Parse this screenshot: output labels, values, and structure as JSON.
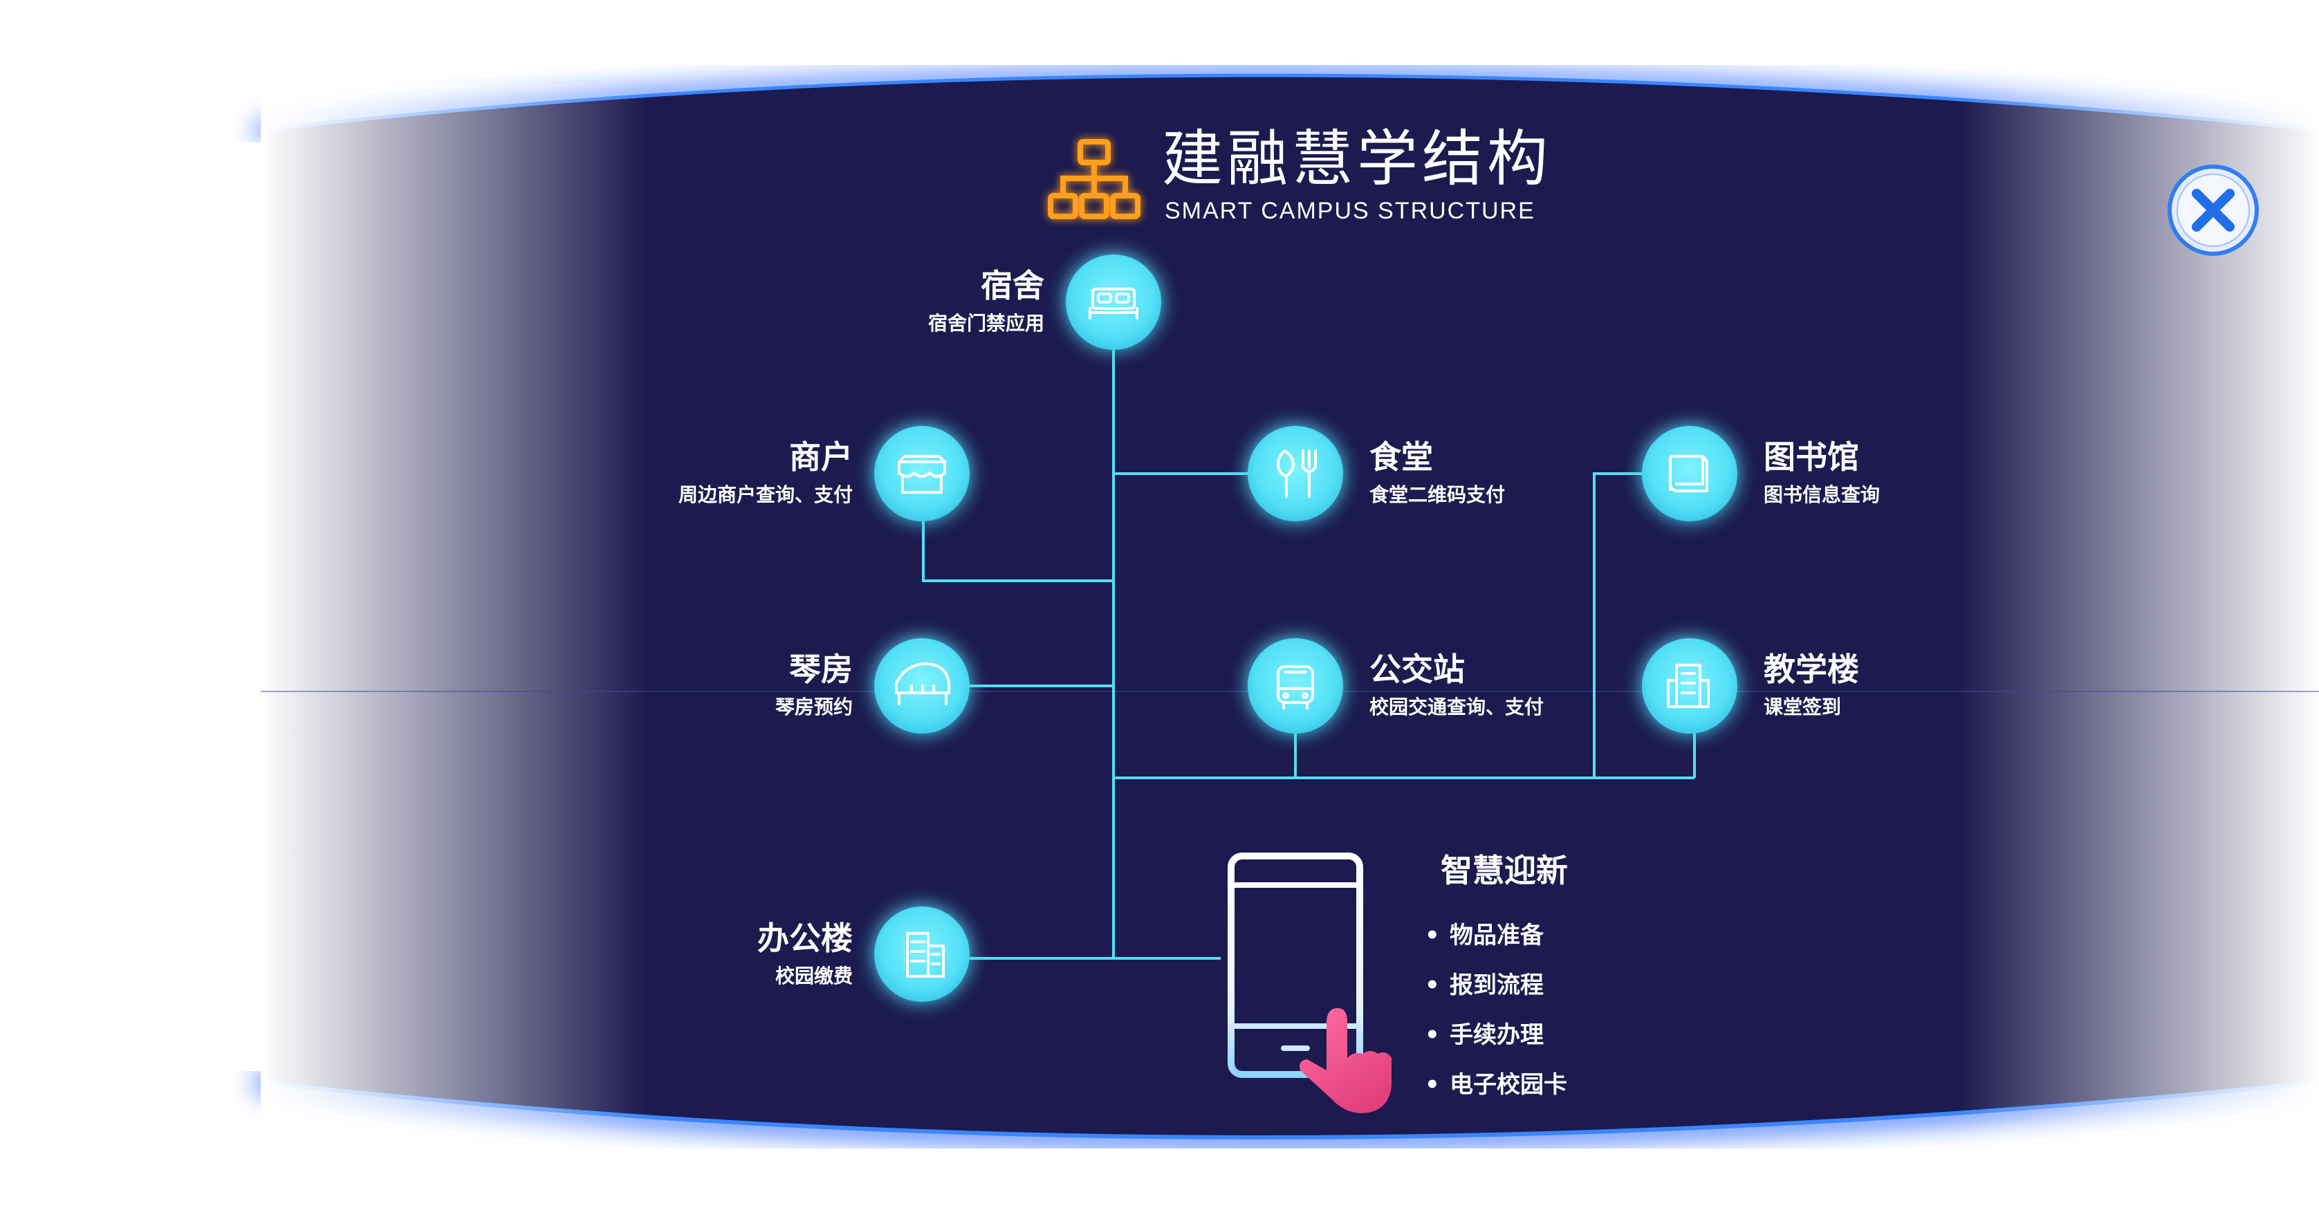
{
  "header": {
    "title": "建融慧学结构",
    "subtitle": "SMART CAMPUS STRUCTURE",
    "logo_icon": "org-chart-icon"
  },
  "close_button_icon": "close-icon",
  "colors": {
    "panel": "#1c1a4e",
    "node": "#5fe8fb",
    "line": "#57dcf2",
    "logo": "#ff9f1a",
    "edge_glow": "#1b4fff"
  },
  "nodes": {
    "dorm": {
      "title": "宿舍",
      "subtitle": "宿舍门禁应用",
      "icon": "bed-icon"
    },
    "merchant": {
      "title": "商户",
      "subtitle": "周边商户查询、支付",
      "icon": "storefront-icon"
    },
    "canteen": {
      "title": "食堂",
      "subtitle": "食堂二维码支付",
      "icon": "cutlery-icon"
    },
    "library": {
      "title": "图书馆",
      "subtitle": "图书信息查询",
      "icon": "book-icon"
    },
    "piano": {
      "title": "琴房",
      "subtitle": "琴房预约",
      "icon": "piano-icon"
    },
    "bus": {
      "title": "公交站",
      "subtitle": "校园交通查询、支付",
      "icon": "bus-icon"
    },
    "teaching": {
      "title": "教学楼",
      "subtitle": "课堂签到",
      "icon": "building-icon"
    },
    "office": {
      "title": "办公楼",
      "subtitle": "校园缴费",
      "icon": "office-building-icon"
    }
  },
  "onboarding": {
    "title": "智慧迎新",
    "icon": "phone-tap-icon",
    "items": [
      "物品准备",
      "报到流程",
      "手续办理",
      "电子校园卡"
    ]
  }
}
